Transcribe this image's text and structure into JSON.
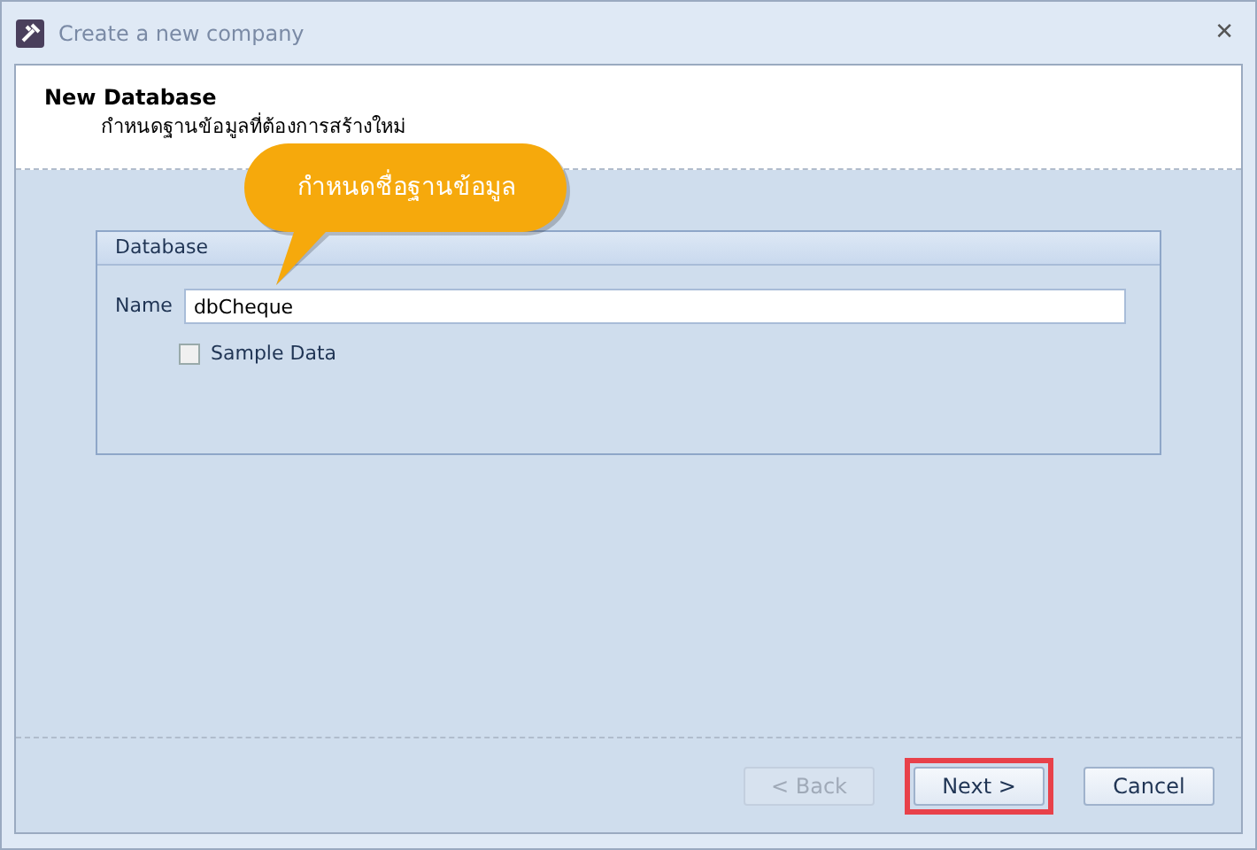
{
  "window": {
    "title": "Create a new company",
    "close": "✕"
  },
  "header": {
    "title": "New Database",
    "subtitle": "กำหนดฐานข้อมูลที่ต้องการสร้างใหม่"
  },
  "callout": {
    "text": "กำหนดชื่อฐานข้อมูล"
  },
  "group": {
    "title": "Database",
    "name_label": "Name",
    "name_value": "dbCheque",
    "sample_data": {
      "label": "Sample Data",
      "checked": false
    }
  },
  "buttons": [
    {
      "label": "< Back",
      "disabled": true,
      "highlighted": false
    },
    {
      "label": "Next >",
      "disabled": false,
      "highlighted": true
    },
    {
      "label": "Cancel",
      "disabled": false,
      "highlighted": false
    }
  ]
}
